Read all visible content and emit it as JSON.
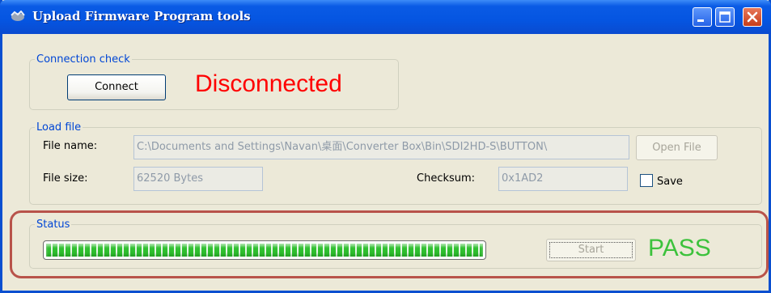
{
  "window": {
    "title": "Upload Firmware Program tools",
    "controls": [
      "minimize-icon",
      "maximize-icon",
      "close-icon"
    ]
  },
  "connection": {
    "legend": "Connection check",
    "connect_label": "Connect",
    "status_text": "Disconnected",
    "status_color": "#ff0000"
  },
  "load_file": {
    "legend": "Load file",
    "file_name_label": "File name:",
    "file_name_value": "C:\\Documents and Settings\\Navan\\桌面\\Converter Box\\Bin\\SDI2HD-S\\BUTTON\\",
    "open_file_label": "Open File",
    "file_size_label": "File size:",
    "file_size_value": "62520 Bytes",
    "checksum_label": "Checksum:",
    "checksum_value": "0x1AD2",
    "save_label": "Save",
    "save_checked": false
  },
  "status": {
    "legend": "Status",
    "progress_fraction": 1.0,
    "start_label": "Start",
    "result_text": "PASS",
    "result_color": "#3cc23c"
  }
}
